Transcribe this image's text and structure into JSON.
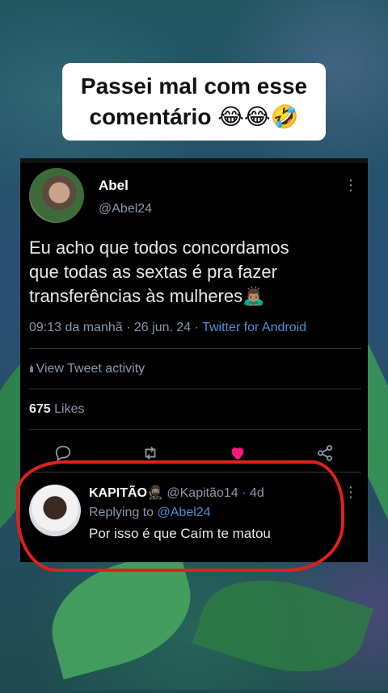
{
  "caption": {
    "line1": "Passei mal com esse",
    "line2": "comentário 😂😂🤣"
  },
  "tweet": {
    "name": "Abel",
    "handle": "@Abel24",
    "text_lines": [
      "Eu acho que todos concordamos",
      "que todas as sextas é pra fazer",
      "transferências às mulheres🙇🏽‍♂️"
    ],
    "time": "09:13 da manhã",
    "date": "26 jun. 24",
    "source": "Twitter for Android",
    "activity_label": "View Tweet activity",
    "likes_count": "675",
    "likes_label": "Likes"
  },
  "reply": {
    "name": "KAPITÃO🥷🏽",
    "handle": "@Kapitão14",
    "age": "4d",
    "replying_prefix": "Replying to",
    "replying_handle": "@Abel24",
    "text": "Por isso é que Caím te matou"
  },
  "colors": {
    "like_heart": "#f91880",
    "link_blue": "#4f8fd6",
    "annotation_red": "#e0201a"
  },
  "icons": [
    "reply-icon",
    "retweet-icon",
    "like-icon",
    "share-icon",
    "more-icon",
    "bar-chart-icon"
  ]
}
